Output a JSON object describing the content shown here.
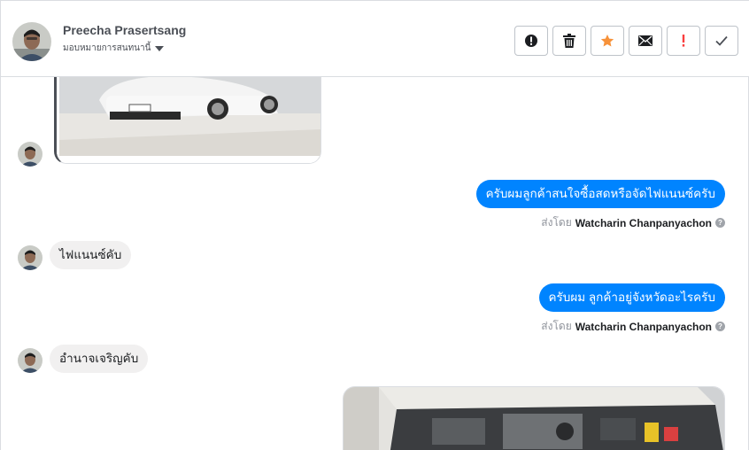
{
  "header": {
    "contact_name": "Preecha Prasertsang",
    "assign_label": "มอบหมายการสนทนานี้",
    "avatar_icon": "user-avatar",
    "actions": [
      {
        "name": "report-spam-button",
        "icon": "exclamation-circle-icon"
      },
      {
        "name": "delete-button",
        "icon": "trash-icon"
      },
      {
        "name": "star-button",
        "icon": "star-icon"
      },
      {
        "name": "mark-unread-button",
        "icon": "envelope-icon"
      },
      {
        "name": "follow-up-button",
        "icon": "exclamation-icon"
      },
      {
        "name": "mark-done-button",
        "icon": "check-icon"
      }
    ]
  },
  "colors": {
    "outgoing_bubble": "#0084ff",
    "incoming_bubble": "#f1f0f0",
    "star": "#f7923a",
    "follow_up": "#fa3e3e"
  },
  "messages": [
    {
      "direction": "in",
      "type": "image",
      "description_icon": "car-photo"
    },
    {
      "direction": "out",
      "text": "ครับผมลูกค้าสนใจซื้อสดหรือจัดไฟแนนซ์ครับ",
      "sent_by_label": "ส่งโดย",
      "sent_by": "Watcharin Chanpanyachon"
    },
    {
      "direction": "in",
      "text": "ไฟแนนซ์คับ"
    },
    {
      "direction": "out",
      "text": "ครับผม ลูกค้าอยู่จังหวัดอะไรครับ",
      "sent_by_label": "ส่งโดย",
      "sent_by": "Watcharin Chanpanyachon"
    },
    {
      "direction": "in",
      "text": "อำนาจเจริญคับ"
    },
    {
      "direction": "out",
      "type": "image",
      "description_icon": "engine-photo"
    }
  ]
}
